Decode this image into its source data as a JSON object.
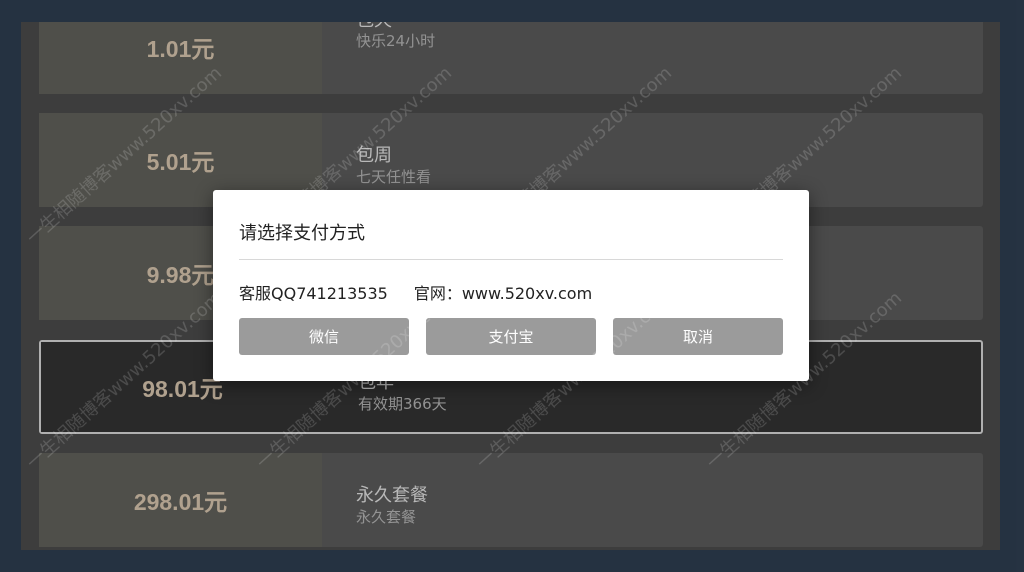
{
  "plans": [
    {
      "price": "1.01元",
      "name": "包天",
      "desc": "快乐24小时"
    },
    {
      "price": "5.01元",
      "name": "包周",
      "desc": "七天任性看"
    },
    {
      "price": "9.98元",
      "name": "",
      "desc": ""
    },
    {
      "price": "98.01元",
      "name": "包年",
      "desc": "有效期366天"
    },
    {
      "price": "298.01元",
      "name": "永久套餐",
      "desc": "永久套餐"
    }
  ],
  "dialog": {
    "title": "请选择支付方式",
    "contact": "客服QQ741213535",
    "website": "官网：www.520xv.com",
    "buttons": {
      "wechat": "微信",
      "alipay": "支付宝",
      "cancel": "取消"
    }
  },
  "watermark": "一生相随博客www.520xv.com",
  "colors": {
    "price": "#c9b8a2",
    "background": "#2b3a4b",
    "button": "#9b9b9b"
  }
}
